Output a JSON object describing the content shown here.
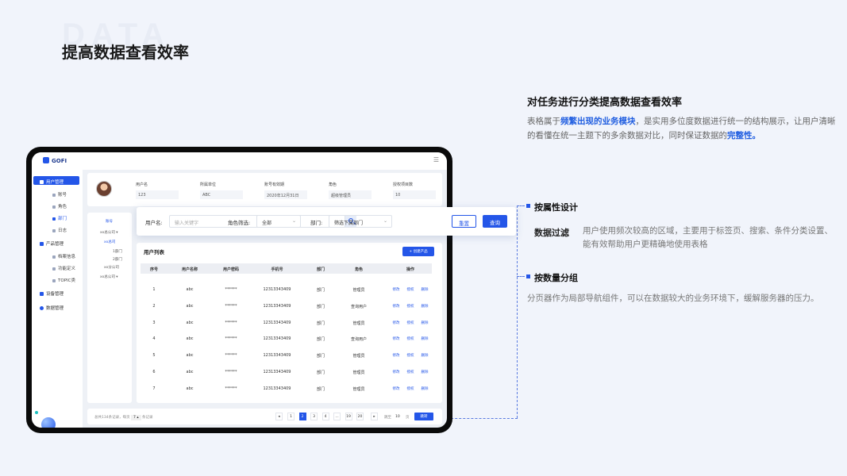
{
  "page": {
    "watermark": "DATA",
    "title": "提高数据查看效率",
    "heading": "对任务进行分类提高数据查看效率",
    "desc_1": "表格属于",
    "desc_hl1": "频繁出现的业务模块",
    "desc_2": "，是实用多位度数据进行统一的结构展示，让用户清晰的看懂在统一主题下的多余数据对比，同时保证数据的",
    "desc_hl2": "完整性。",
    "section1_title": "按属性设计",
    "section1_label": "数据过滤",
    "section1_text": "用户使用频次较高的区域，主要用于标签页、搜索、条件分类设置、能有效帮助用户更精确地使用表格",
    "section2_title": "按数量分组",
    "section2_text": "分页器作为局部导航组件，可以在数据较大的业务环境下，缓解服务器的压力。"
  },
  "colors": {
    "accent": "#2456e8",
    "background": "#f1f4fb"
  },
  "app": {
    "logo": "GOFI",
    "menu_icon": "hamburger-icon",
    "sidebar": {
      "user_mgmt": "用户管理",
      "account": "账号",
      "role": "角色",
      "dept": "部门",
      "log": "日志",
      "product_mgmt": "产品管理",
      "product_info": "档案信息",
      "feature_def": "功能定义",
      "topic": "TOPIC类",
      "device_mgmt": "设备管理",
      "data_mgmt": "数据管理"
    },
    "info": {
      "username_label": "用户名",
      "username_value": "123",
      "unit_label": "所属单位",
      "unit_value": "ABC",
      "expire_label": "账号有效期",
      "expire_value": "2020年12月31日",
      "role_label": "角色",
      "role_value": "超级管理员",
      "days_label": "授权项目数",
      "days_value": "10"
    },
    "tree": {
      "header": "账号",
      "n1": "xx总公司 ▾",
      "n2": "xx总司",
      "n3": "1部门",
      "n4": "2部门",
      "n5": "xx分公司",
      "n6": "xx总公司 ▾"
    },
    "filter": {
      "username_label": "用户名:",
      "username_placeholder": "输入关键字",
      "role_label": "角色筛选:",
      "role_value": "全部",
      "dept_label": "部门:",
      "dept_value": "筛选下属部门",
      "reset": "重置",
      "query": "查询"
    },
    "list": {
      "title": "用户列表",
      "new_button": "+ 创建产品",
      "columns": [
        "序号",
        "用户名称",
        "用户密码",
        "手机号",
        "部门",
        "角色",
        "操作"
      ],
      "rows": [
        [
          "1",
          "abc",
          "******",
          "12313343409",
          "部门",
          "管理员"
        ],
        [
          "2",
          "abc",
          "******",
          "12313343409",
          "部门",
          "查询用户"
        ],
        [
          "3",
          "abc",
          "******",
          "12313343409",
          "部门",
          "管理员"
        ],
        [
          "4",
          "abc",
          "******",
          "12313343409",
          "部门",
          "查询用户"
        ],
        [
          "5",
          "abc",
          "******",
          "12313343409",
          "部门",
          "管理员"
        ],
        [
          "6",
          "abc",
          "******",
          "12313343409",
          "部门",
          "管理员"
        ],
        [
          "7",
          "abc",
          "******",
          "12313343409",
          "部门",
          "管理员"
        ]
      ],
      "ops": [
        "修改",
        "授权",
        "删除"
      ]
    },
    "pagination": {
      "info_prefix": "总共134条记录，每页",
      "per_page": "7 ▴",
      "info_suffix": "条记录",
      "prev": "◂",
      "pages": [
        "1",
        "2",
        "3",
        "4",
        "...",
        "19",
        "20"
      ],
      "current": "2",
      "next": "▸",
      "jump_prefix": "跳至",
      "jump_value": "10",
      "jump_suffix": "页",
      "go": "跳转"
    }
  }
}
